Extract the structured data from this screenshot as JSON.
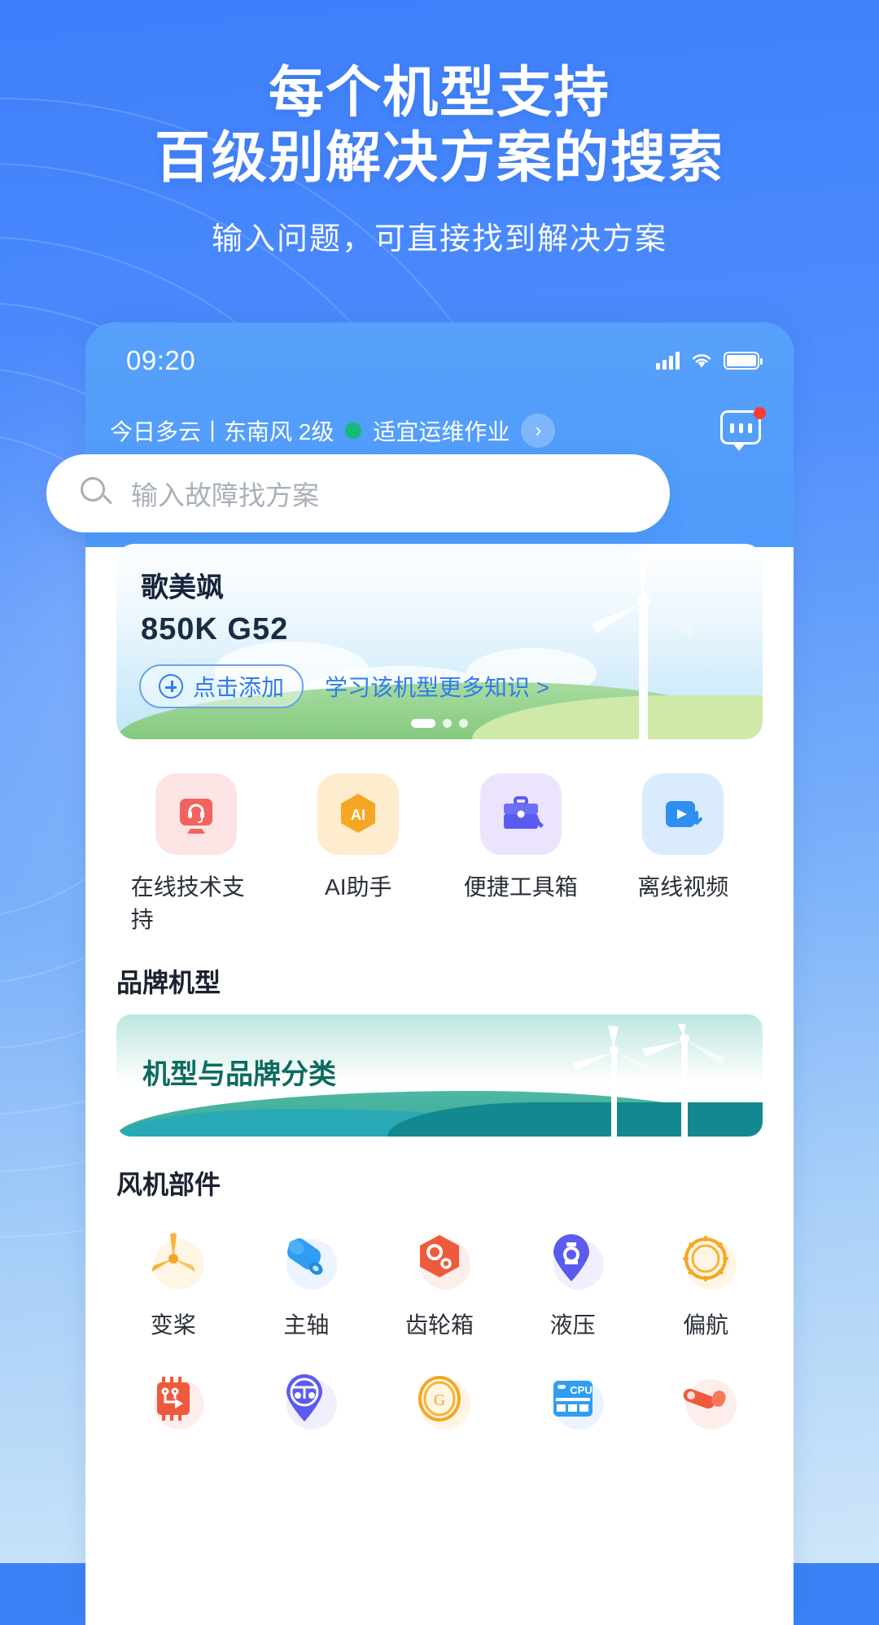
{
  "promo": {
    "headline_line1": "每个机型支持",
    "headline_line2": "百级别解决方案的搜索",
    "subtitle": "输入问题，可直接找到解决方案"
  },
  "status_bar": {
    "time": "09:20",
    "signal_icon": "cellular-signal-icon",
    "wifi_icon": "wifi-icon",
    "battery_icon": "battery-icon"
  },
  "weather_bar": {
    "text": "今日多云丨东南风 2级",
    "status_dot_color": "#17b978",
    "status_text": "适宜运维作业",
    "chevron_icon": "chevron-right-icon",
    "message_icon": "message-icon",
    "badge_color": "#ff3b30"
  },
  "search": {
    "placeholder": "输入故障找方案",
    "icon": "search-icon"
  },
  "hero_card": {
    "brand": "歌美飒",
    "model": "850K G52",
    "add_button": "点击添加",
    "add_icon": "plus-circle-icon",
    "learn_link": "学习该机型更多知识 >",
    "carousel_total": 3,
    "carousel_active": 1,
    "illustration": "wind-turbine-illustration"
  },
  "quick_actions": [
    {
      "label": "在线技术支持",
      "icon": "headset-support-icon",
      "bg": "#fde4e4",
      "fg": "#f2635f"
    },
    {
      "label": "AI助手",
      "icon": "ai-hexagon-icon",
      "bg": "#fdeccd",
      "fg": "#f5a623"
    },
    {
      "label": "便捷工具箱",
      "icon": "toolbox-wrench-icon",
      "bg": "#ece4fc",
      "fg": "#5b5bf0"
    },
    {
      "label": "离线视频",
      "icon": "video-download-icon",
      "bg": "#d9ebfd",
      "fg": "#2f8ff0"
    }
  ],
  "sections": {
    "brand_models_title": "品牌机型",
    "components_title": "风机部件"
  },
  "brand_banner": {
    "title": "机型与品牌分类",
    "illustration": "wind-turbines-hills-illustration"
  },
  "components": [
    {
      "label": "变桨",
      "icon": "pitch-blade-icon",
      "color": "#f5a623",
      "halo": "#fdeccd"
    },
    {
      "label": "主轴",
      "icon": "main-shaft-icon",
      "color": "#2f9df4",
      "halo": "#d9e9fd"
    },
    {
      "label": "齿轮箱",
      "icon": "gearbox-icon",
      "color": "#f05a3c",
      "halo": "#fde0da"
    },
    {
      "label": "液压",
      "icon": "hydraulic-icon",
      "color": "#5b5bf0",
      "halo": "#e6e2fc"
    },
    {
      "label": "偏航",
      "icon": "yaw-bearing-icon",
      "color": "#f5a623",
      "halo": "#fdeccd"
    },
    {
      "label": "",
      "icon": "control-board-icon",
      "color": "#f05a3c",
      "halo": "#fde0da"
    },
    {
      "label": "",
      "icon": "alignment-icon",
      "color": "#5b5bf0",
      "halo": "#e6e2fc"
    },
    {
      "label": "",
      "icon": "generator-icon",
      "color": "#f5a623",
      "halo": "#fdeccd"
    },
    {
      "label": "",
      "icon": "cpu-icon",
      "color": "#2f9df4",
      "halo": "#d9e9fd"
    },
    {
      "label": "",
      "icon": "sensor-icon",
      "color": "#f05a3c",
      "halo": "#fde0da"
    }
  ]
}
